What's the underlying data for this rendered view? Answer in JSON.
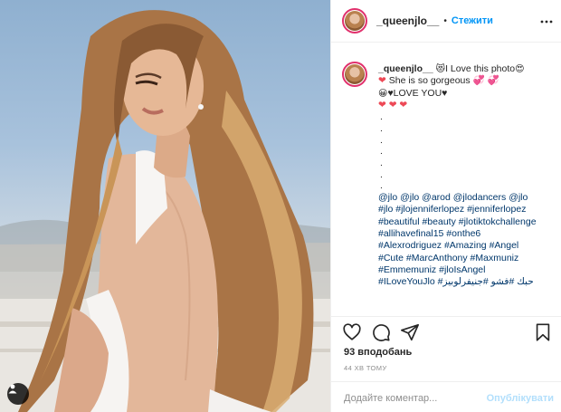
{
  "post": {
    "username": "_queenjlo__",
    "follow_label": "Стежити",
    "dot": "•"
  },
  "caption": {
    "username": "_queenjlo__",
    "line1": "I Love this photo",
    "line2": "She is so gorgeous",
    "line3": "LOVE YOU",
    "dots": [
      ".",
      ".",
      ".",
      ".",
      ".",
      ".",
      "."
    ],
    "hashtag_lines": [
      "@jlo @jlo @arod @jlodancers @jlo",
      "#jlo #jlojenniferlopez #jenniferlopez",
      "#beautiful #beauty #jlotiktokchallenge",
      "#allihavefinal15 #onthe6",
      "#Alexrodriguez #Amazing #Angel",
      "#Cute #MarcAnthony #Maxmuniz",
      "#Emmemuniz #jloIsAngel",
      "#ILoveYouJlo #حبك #فشو #جنيفرلوبيز"
    ]
  },
  "stats": {
    "likes": "93 вподобань",
    "time": "44 хв тому"
  },
  "comment": {
    "placeholder": "Додайте коментар...",
    "publish_label": "Опублікувати"
  },
  "icons": {
    "like": "heart-outline-icon",
    "comment": "comment-bubble-icon",
    "share": "paper-plane-icon",
    "save": "bookmark-icon",
    "more": "more-dots-icon",
    "tag": "user-tag-icon"
  },
  "colors": {
    "link": "#0095f6",
    "hashtag": "#00376b",
    "publish_disabled": "#b2dffc",
    "heart": "#ed4956",
    "story_ring": "#e1306c"
  }
}
